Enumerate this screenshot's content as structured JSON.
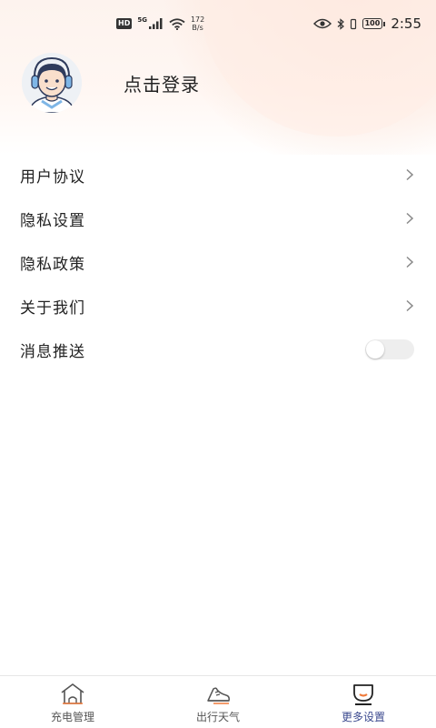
{
  "status_bar": {
    "hd": "HD",
    "network": "5G",
    "speed_value": "172",
    "speed_unit": "B/s",
    "battery": "100",
    "time": "2:55"
  },
  "profile": {
    "login_label": "点击登录"
  },
  "menu": {
    "items": [
      {
        "label": "用户协议"
      },
      {
        "label": "隐私设置"
      },
      {
        "label": "隐私政策"
      },
      {
        "label": "关于我们"
      },
      {
        "label": "消息推送",
        "toggle_on": false
      }
    ]
  },
  "tabbar": {
    "tabs": [
      {
        "label": "充电管理",
        "icon": "house-icon",
        "active": false
      },
      {
        "label": "出行天气",
        "icon": "sneaker-icon",
        "active": false
      },
      {
        "label": "更多设置",
        "icon": "cup-icon",
        "active": true
      }
    ]
  },
  "colors": {
    "accent": "#3c4a8f",
    "indicator": "#f07a3a",
    "header_tint": "#fdf3ee"
  }
}
